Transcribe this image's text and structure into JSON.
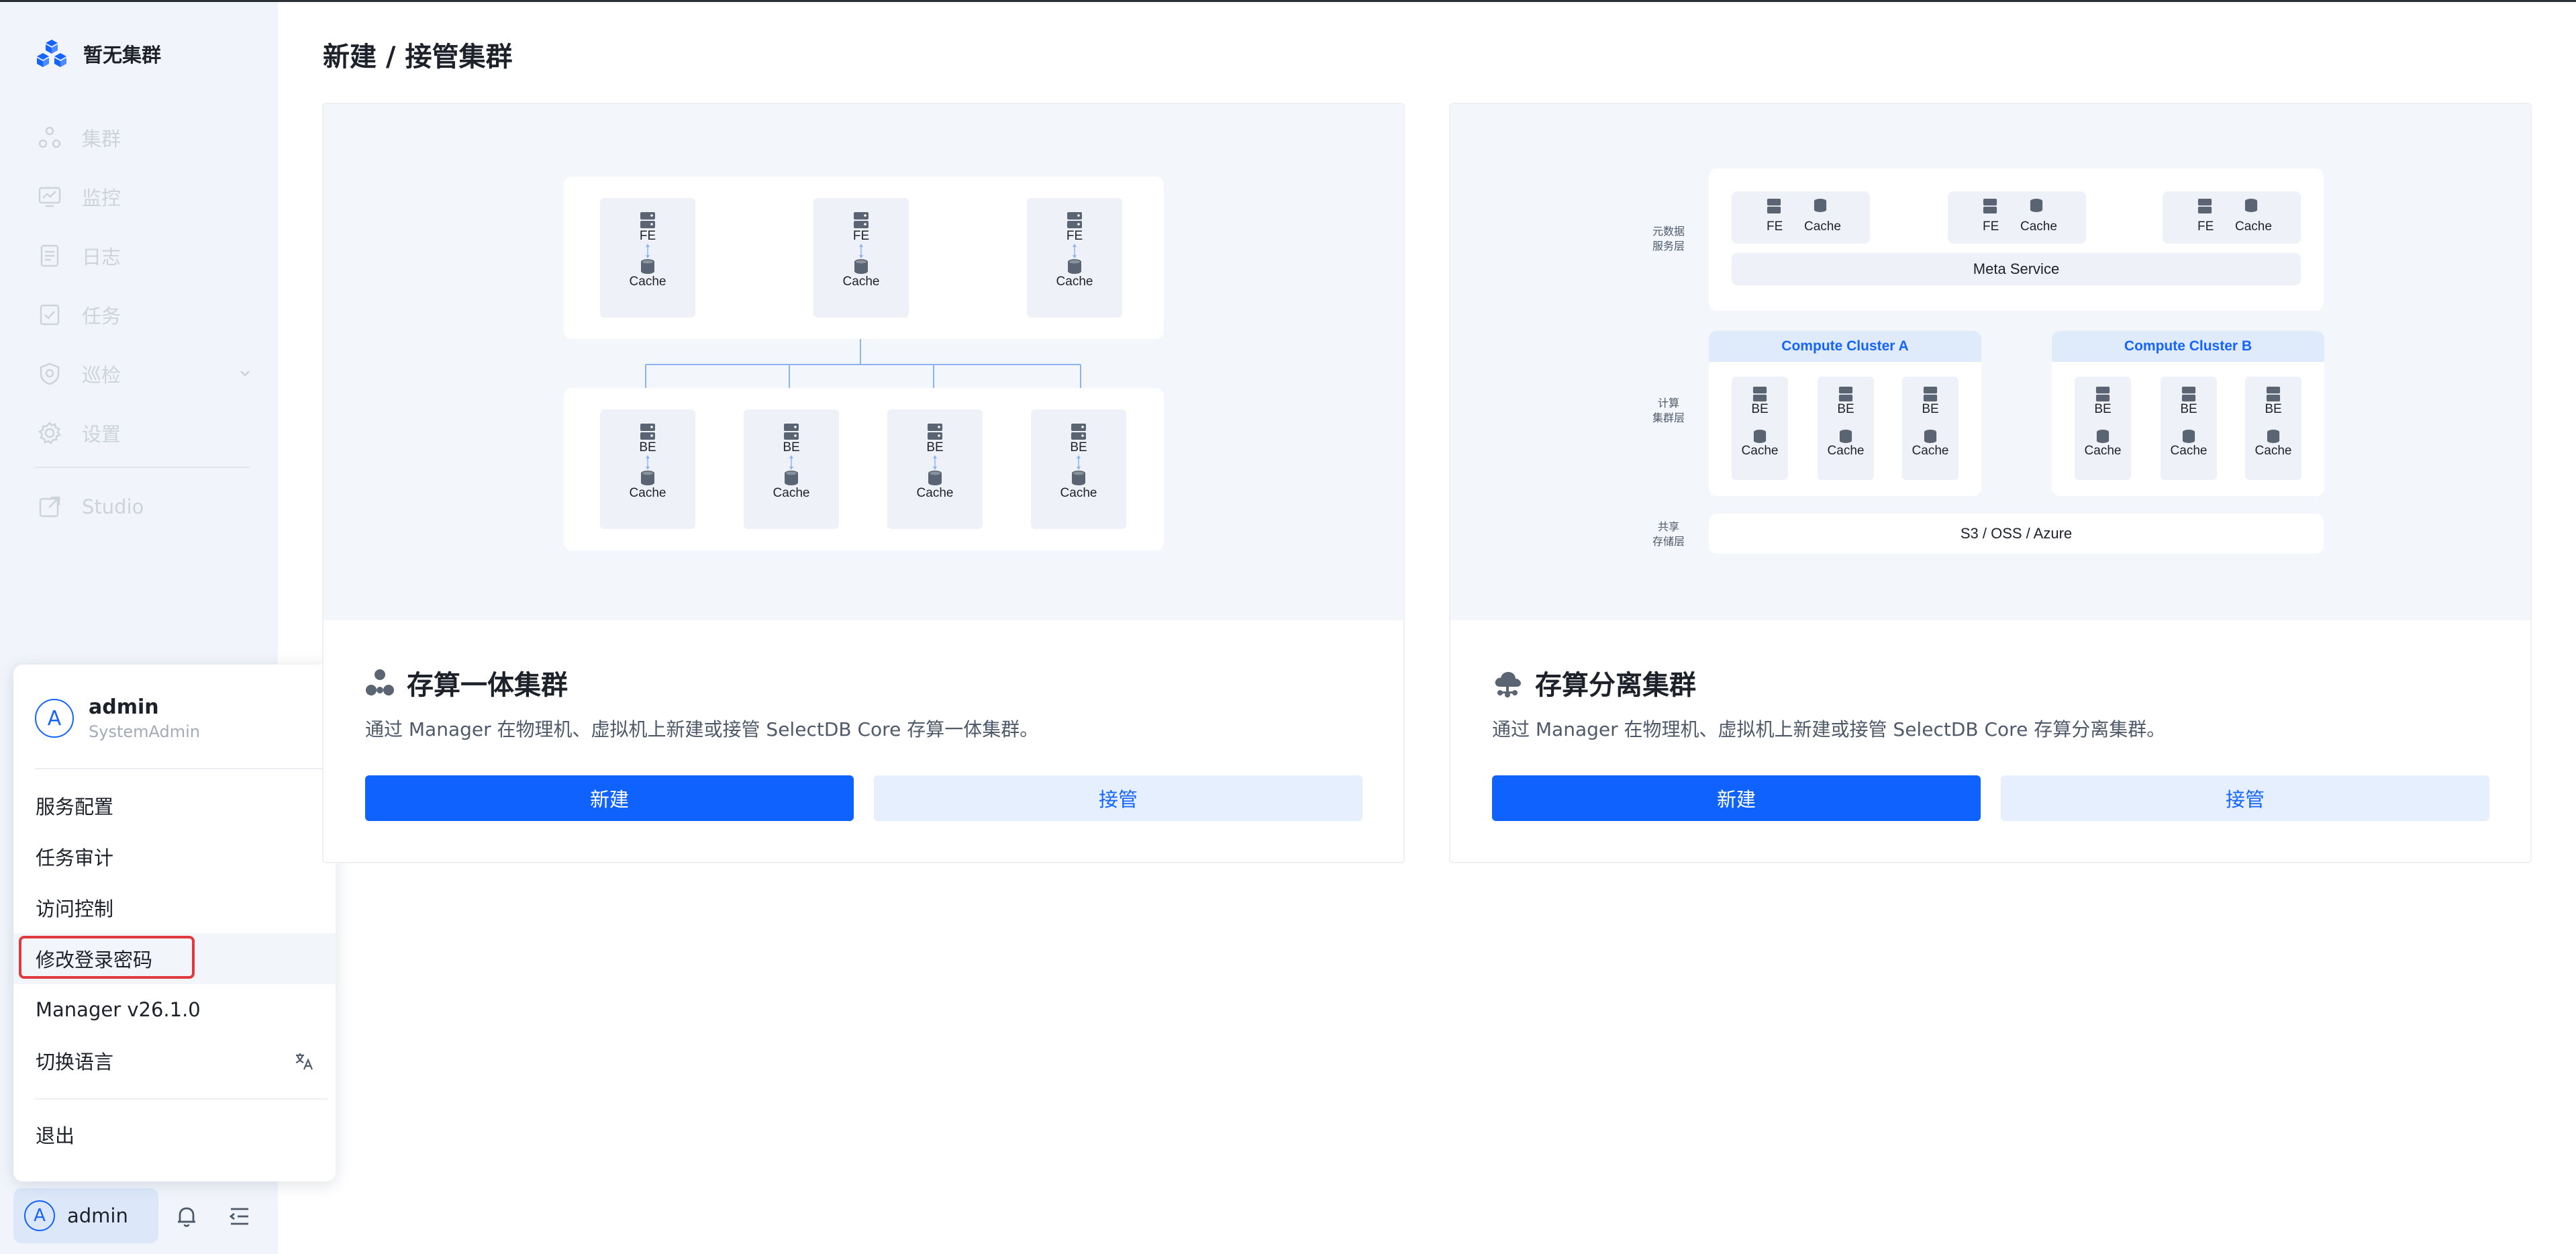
{
  "brand": {
    "name": "暂无集群"
  },
  "sidebar": {
    "items": [
      {
        "label": "集群",
        "icon": "cluster-icon"
      },
      {
        "label": "监控",
        "icon": "monitor-icon"
      },
      {
        "label": "日志",
        "icon": "log-icon"
      },
      {
        "label": "任务",
        "icon": "task-icon"
      },
      {
        "label": "巡检",
        "icon": "inspect-icon"
      },
      {
        "label": "设置",
        "icon": "settings-icon"
      }
    ],
    "studio": "Studio",
    "user_chip": {
      "avatar": "A",
      "name": "admin"
    }
  },
  "popup": {
    "avatar": "A",
    "name": "admin",
    "role": "SystemAdmin",
    "menu": [
      "服务配置",
      "任务审计",
      "访问控制",
      "修改登录密码",
      "Manager v26.1.0",
      "切换语言"
    ],
    "logout": "退出"
  },
  "page": {
    "title": "新建 / 接管集群"
  },
  "cards": [
    {
      "title": "存算一体集群",
      "desc": "通过 Manager 在物理机、虚拟机上新建或接管 SelectDB Core 存算一体集群。",
      "primary": "新建",
      "secondary": "接管",
      "diagram": {
        "fe": "FE",
        "be": "BE",
        "cache": "Cache"
      }
    },
    {
      "title": "存算分离集群",
      "desc": "通过 Manager 在物理机、虚拟机上新建或接管 SelectDB Core 存算分离集群。",
      "primary": "新建",
      "secondary": "接管",
      "diagram": {
        "meta_layer": [
          "元数据",
          "服务层"
        ],
        "compute_layer": [
          "计算",
          "集群层"
        ],
        "storage_layer": [
          "共享",
          "存储层"
        ],
        "meta_service": "Meta Service",
        "cluster_a": "Compute Cluster A",
        "cluster_b": "Compute Cluster B",
        "storage": "S3 / OSS / Azure",
        "fe": "FE",
        "be": "BE",
        "cache": "Cache"
      }
    }
  ],
  "colors": {
    "primary": "#0f62fe",
    "highlight": "#e0393e",
    "sidebar_bg": "#f1f5fb"
  }
}
